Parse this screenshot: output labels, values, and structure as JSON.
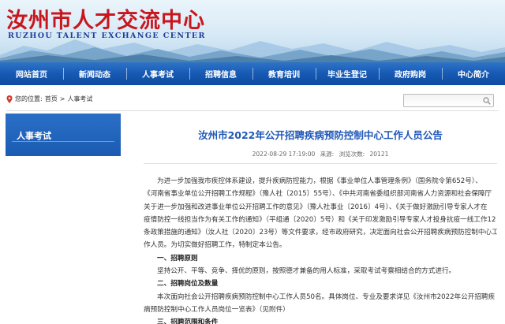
{
  "header": {
    "site_title": "汝州市人才交流中心",
    "site_subtitle": "RUZHOU TALENT EXCHANGE CENTER",
    "title_color": "#c8161d",
    "subtitle_color": "#1d3f9a"
  },
  "nav": {
    "items": [
      "网站首页",
      "新闻动态",
      "人事考试",
      "招聘信息",
      "教育培训",
      "毕业生登记",
      "政府购岗",
      "中心简介"
    ],
    "bg_color": "#1659b4"
  },
  "breadcrumb": {
    "prefix": "您的位置:",
    "home": "首页",
    "separator": ">",
    "current": "人事考试"
  },
  "search": {
    "value": "",
    "placeholder": "",
    "icon": "search-icon"
  },
  "sidebar": {
    "title": "人事考试"
  },
  "article": {
    "title": "汝州市2022年公开招聘疾病预防控制中心工作人员公告",
    "date": "2022-08-29 17:19:00",
    "source_label": "来源:",
    "source_value": "",
    "views_label": "浏览次数:",
    "views": "20121",
    "lines": [
      "为进一步加强我市疾控体系建设，提升疾病防控能力，根据《事业单位人事管理条例》（国务院令第652号）、",
      "《河南省事业单位公开招聘工作规程》（豫人社〔2015〕55号）、《中共河南省委组织部河南省人力资源和社会保障厅",
      "关于进一步加强和改进事业单位公开招聘工作的意见》（豫人社事业〔2016〕4号）、《关于做好激励引导专家人才在",
      "疫情防控一线担当作为有关工作的通知》（平组通〔2020〕5号）和《关于印发激励引导专家人才投身抗疫一线工作12",
      "条政策措施的通知》（汝人社〔2020〕23号）等文件要求，经市政府研究，决定面向社会公开招聘疾病预防控制中心工",
      "作人员。为切实做好招聘工作，特制定本公告。"
    ],
    "section1_heading": "一、招聘原则",
    "section1_text": "坚持公开、平等、竞争、择优的原则，按照德才兼备的用人标准，采取考试考察相结合的方式进行。",
    "section2_heading": "二、招聘岗位及数量",
    "section2_lines": [
      "本次面向社会公开招聘疾病预防控制中心工作人员50名。具体岗位、专业及要求详见《汝州市2022年公开招聘疾",
      "病预防控制中心工作人员岗位一览表》（见附件）"
    ],
    "section3_heading": "三、招聘范围和条件"
  }
}
